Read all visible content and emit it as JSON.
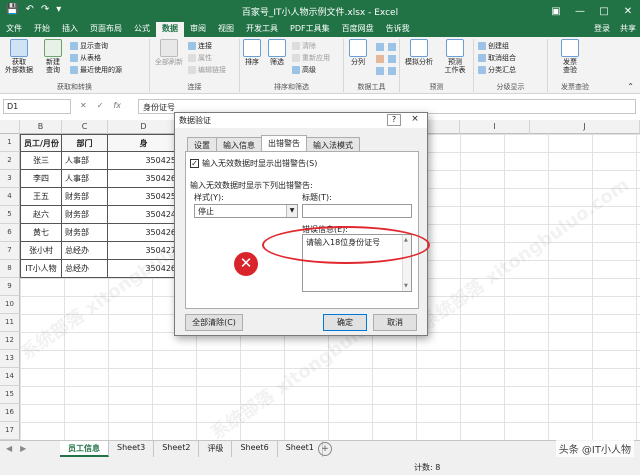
{
  "titlebar": {
    "title": "百家号_IT小人物示例文件.xlsx - Excel",
    "save_icon": "save-icon",
    "undo_icon": "undo-icon",
    "redo_icon": "redo-icon"
  },
  "tabs": [
    "文件",
    "开始",
    "插入",
    "页面布局",
    "公式",
    "数据",
    "审阅",
    "视图",
    "开发工具",
    "PDF工具集",
    "百度网盘",
    "告诉我"
  ],
  "active_tab": "数据",
  "account": {
    "login": "登录",
    "share": "共享"
  },
  "ribbon": {
    "get_external": "获取\n外部数据",
    "new_query": "新建\n查询",
    "show_query": "显示查询",
    "from_table": "从表格",
    "recent_sources": "最近使用的源",
    "group_get": "获取和转换",
    "refresh_all": "全部刷新",
    "connections": "连接",
    "properties": "属性",
    "edit_links": "编辑链接",
    "group_conn": "连接",
    "sort": "排序",
    "filter": "筛选",
    "clear": "清除",
    "reapply": "重新应用",
    "advanced": "高级",
    "group_sort": "排序和筛选",
    "split": "分列",
    "group_tools": "数据工具",
    "whatif": "模拟分析",
    "forecast": "预测\n工作表",
    "group_forecast": "预测",
    "group_create": "创建组",
    "ungroup": "取消组合",
    "subtotal": "分类汇总",
    "group_outline": "分级显示",
    "invoice": "发票\n查验",
    "group_invoice": "发票查验"
  },
  "formula_bar": {
    "name_box": "D1",
    "formula": "身份证号"
  },
  "columns": [
    "B",
    "C",
    "D",
    "E",
    "F",
    "G",
    "H",
    "I",
    "J"
  ],
  "rows": [
    "1",
    "2",
    "3",
    "4",
    "5",
    "6",
    "7",
    "8",
    "9",
    "10",
    "11",
    "12",
    "13",
    "14",
    "15",
    "16",
    "17"
  ],
  "table": {
    "headers": [
      "员工/月份",
      "部门",
      "身"
    ],
    "data": [
      [
        "张三",
        "人事部",
        "350425"
      ],
      [
        "李四",
        "人事部",
        "350426"
      ],
      [
        "王五",
        "财务部",
        "350425"
      ],
      [
        "赵六",
        "财务部",
        "350424"
      ],
      [
        "黄七",
        "财务部",
        "350426"
      ],
      [
        "张小村",
        "总经办",
        "350427"
      ],
      [
        "IT小人物",
        "总经办",
        "350426"
      ]
    ]
  },
  "dialog": {
    "title": "数据验证",
    "help": "?",
    "close": "×",
    "tabs": [
      "设置",
      "输入信息",
      "出错警告",
      "输入法模式"
    ],
    "active_tab": "出错警告",
    "show_alert": "输入无效数据时显示出错警告(S)",
    "show_alert_checked": "✓",
    "section_label": "输入无效数据时显示下列出错警告:",
    "style_label": "样式(Y):",
    "style_value": "停止",
    "title_label": "标题(T):",
    "message_label": "错误信息(E):",
    "message_value": "请输入18位身份证号",
    "clear_all": "全部清除(C)",
    "ok": "确定",
    "cancel": "取消"
  },
  "sheets": [
    "员工信息",
    "Sheet3",
    "Sheet2",
    "评级",
    "Sheet6",
    "Sheet1"
  ],
  "active_sheet": "员工信息",
  "status": {
    "count": "计数: 8"
  },
  "brand": "头条 @IT小人物",
  "watermark": "系统部落 xitongbuluo.com",
  "colors": {
    "excel_green": "#217346",
    "error_red": "#d9242b",
    "annotation_red": "#e0282e"
  }
}
